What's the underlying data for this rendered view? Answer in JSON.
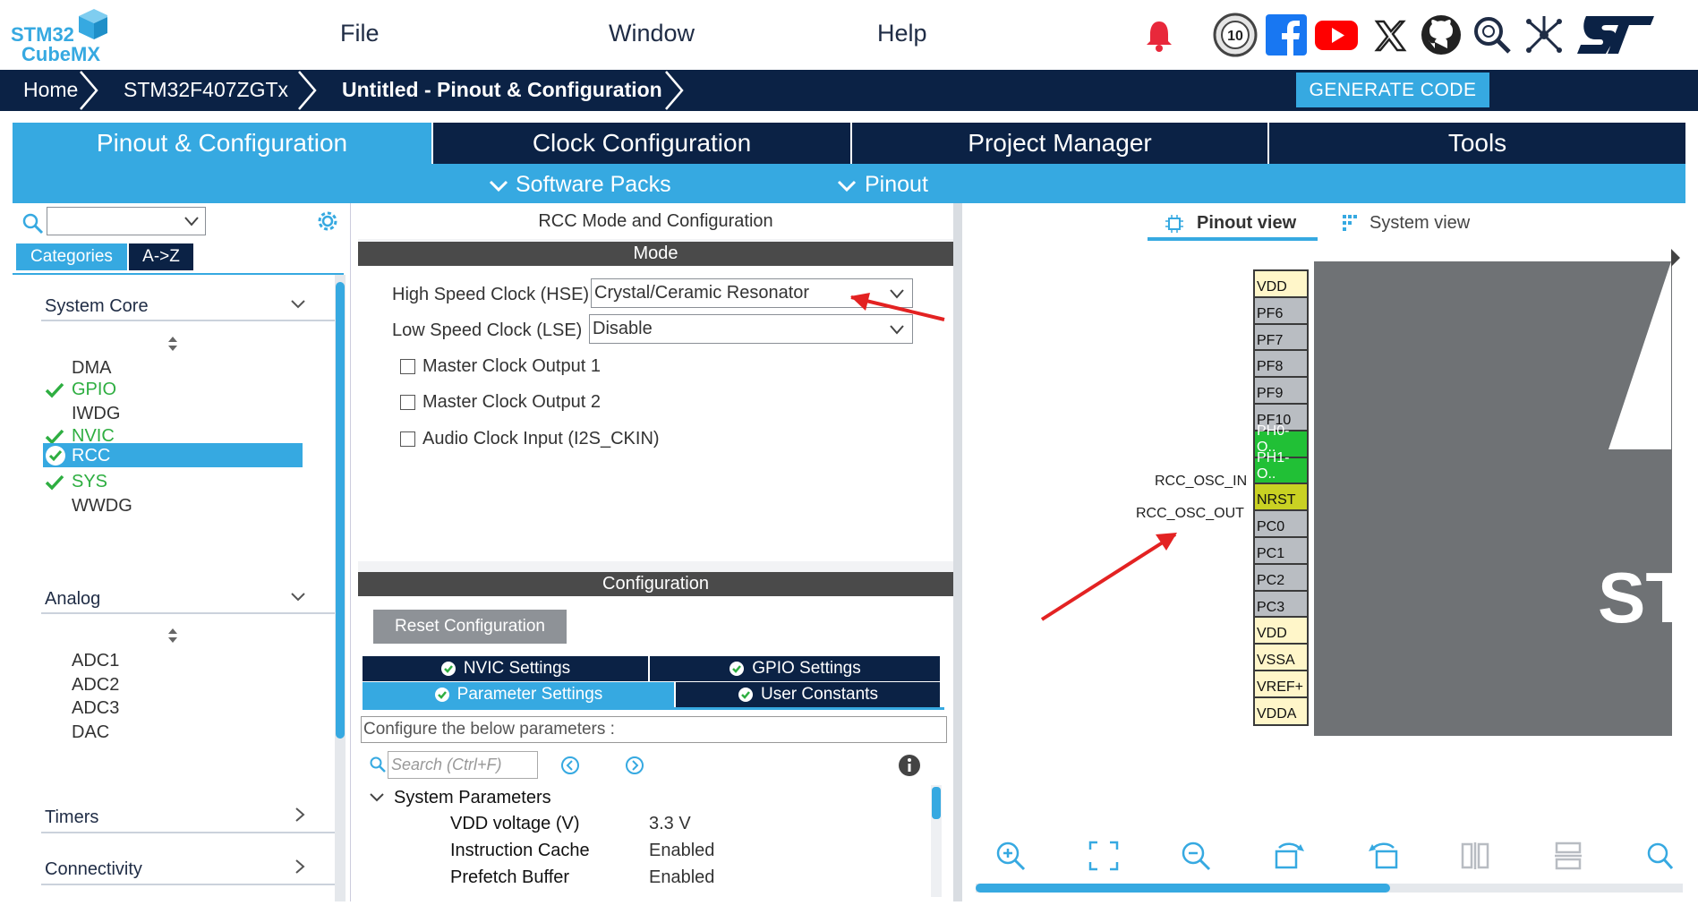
{
  "app": {
    "logo_line1": "STM32",
    "logo_line2": "CubeMX",
    "menus": [
      "File",
      "Window",
      "Help"
    ]
  },
  "breadcrumb": {
    "home": "Home",
    "device": "STM32F407ZGTx",
    "current": "Untitled - Pinout & Configuration"
  },
  "toolbar": {
    "generate_label": "GENERATE CODE"
  },
  "tabs": {
    "main": [
      "Pinout & Configuration",
      "Clock Configuration",
      "Project Manager",
      "Tools"
    ],
    "sub": [
      "Software Packs",
      "Pinout"
    ]
  },
  "left": {
    "search_placeholder": "",
    "tab_categories": "Categories",
    "tab_az": "A->Z",
    "categories": [
      {
        "name": "System Core",
        "items": [
          {
            "label": "DMA",
            "status": "none"
          },
          {
            "label": "GPIO",
            "status": "ok"
          },
          {
            "label": "IWDG",
            "status": "none"
          },
          {
            "label": "NVIC",
            "status": "ok"
          },
          {
            "label": "RCC",
            "status": "selected"
          },
          {
            "label": "SYS",
            "status": "ok"
          },
          {
            "label": "WWDG",
            "status": "none"
          }
        ]
      },
      {
        "name": "Analog",
        "items": [
          {
            "label": "ADC1"
          },
          {
            "label": "ADC2"
          },
          {
            "label": "ADC3"
          },
          {
            "label": "DAC"
          }
        ]
      },
      {
        "name": "Timers",
        "items": []
      },
      {
        "name": "Connectivity",
        "items": []
      }
    ]
  },
  "mid": {
    "title": "RCC Mode and Configuration",
    "mode_header": "Mode",
    "hse_label": "High Speed Clock (HSE)",
    "hse_value": "Crystal/Ceramic Resonator",
    "lse_label": "Low Speed Clock (LSE)",
    "lse_value": "Disable",
    "checkboxes": [
      "Master Clock Output 1",
      "Master Clock Output 2",
      "Audio Clock Input (I2S_CKIN)"
    ],
    "config_header": "Configuration",
    "reset_label": "Reset Configuration",
    "cfg_tabs": [
      "NVIC Settings",
      "GPIO Settings",
      "Parameter Settings",
      "User Constants"
    ],
    "configure_text": "Configure the below parameters :",
    "search_placeholder": "Search (Ctrl+F)",
    "group_title": "System Parameters",
    "params": [
      {
        "name": "VDD voltage (V)",
        "value": "3.3 V"
      },
      {
        "name": "Instruction Cache",
        "value": "Enabled"
      },
      {
        "name": "Prefetch Buffer",
        "value": "Enabled"
      }
    ]
  },
  "right": {
    "view_tabs": [
      "Pinout view",
      "System view"
    ],
    "pins": [
      {
        "label": "VDD",
        "type": "yellow"
      },
      {
        "label": "PF6",
        "type": "gray"
      },
      {
        "label": "PF7",
        "type": "gray"
      },
      {
        "label": "PF8",
        "type": "gray"
      },
      {
        "label": "PF9",
        "type": "gray"
      },
      {
        "label": "PF10",
        "type": "gray"
      },
      {
        "label": "PH0-O..",
        "type": "green",
        "signal": "RCC_OSC_IN"
      },
      {
        "label": "PH1-O..",
        "type": "green",
        "signal": "RCC_OSC_OUT"
      },
      {
        "label": "NRST",
        "type": "lime"
      },
      {
        "label": "PC0",
        "type": "gray"
      },
      {
        "label": "PC1",
        "type": "gray"
      },
      {
        "label": "PC2",
        "type": "gray"
      },
      {
        "label": "PC3",
        "type": "gray"
      },
      {
        "label": "VDD",
        "type": "yellow"
      },
      {
        "label": "VSSA",
        "type": "yellow"
      },
      {
        "label": "VREF+",
        "type": "yellow"
      },
      {
        "label": "VDDA",
        "type": "yellow"
      }
    ],
    "chip_text": "ST"
  },
  "colors": {
    "navy": "#0b2245",
    "accent": "#36a9e1",
    "ok_green": "#2eae41",
    "pin_green": "#21c036"
  }
}
